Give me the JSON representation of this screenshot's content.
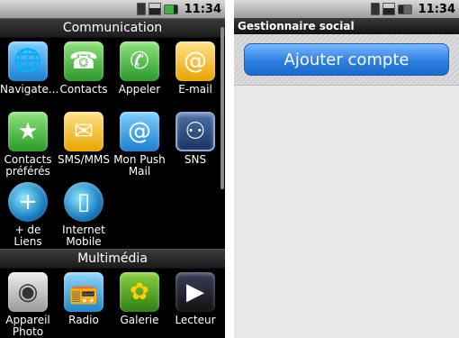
{
  "status": {
    "time": "11:34"
  },
  "left": {
    "sections": [
      {
        "title": "Communication",
        "apps": [
          {
            "label": "Navigate...",
            "icon": "globe-icon"
          },
          {
            "label": "Contacts",
            "icon": "phone-card-icon"
          },
          {
            "label": "Appeler",
            "icon": "phone-dial-icon"
          },
          {
            "label": "E-mail",
            "icon": "at-sign-icon"
          },
          {
            "label": "Contacts préférés",
            "icon": "star-contact-icon"
          },
          {
            "label": "SMS/MMS",
            "icon": "envelope-icon"
          },
          {
            "label": "Mon Push Mail",
            "icon": "push-mail-icon"
          },
          {
            "label": "SNS",
            "icon": "people-icon"
          },
          {
            "label": "+ de Liens",
            "icon": "globe-plus-icon"
          },
          {
            "label": "Internet Mobile",
            "icon": "globe-mobile-icon"
          }
        ]
      },
      {
        "title": "Multimédia",
        "apps": [
          {
            "label": "Appareil Photo",
            "icon": "camera-icon"
          },
          {
            "label": "Radio",
            "icon": "radio-icon"
          },
          {
            "label": "Galerie",
            "icon": "flower-icon"
          },
          {
            "label": "Lecteur",
            "icon": "film-icon"
          }
        ]
      }
    ]
  },
  "right": {
    "title": "Gestionnaire social",
    "add_button": "Ajouter compte"
  }
}
